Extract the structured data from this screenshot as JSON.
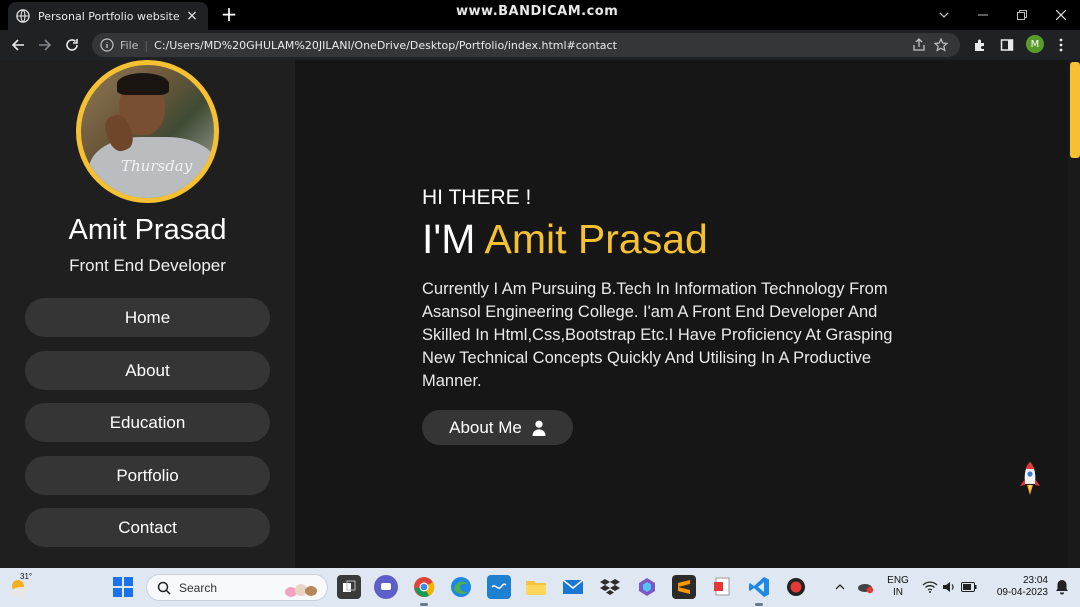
{
  "browser": {
    "tab_title": "Personal Portfolio website",
    "tab_close": "×",
    "new_tab": "+",
    "watermark": "www.BANDICAM.com",
    "omnibox_scheme": "File",
    "omnibox_sep": "|",
    "url": "C:/Users/MD%20GHULAM%20JILANI/OneDrive/Desktop/Portfolio/index.html#contact",
    "profile_initial": "M"
  },
  "sidebar": {
    "avatar_signature": "Thursday",
    "name": "Amit Prasad",
    "role": "Front End Developer",
    "nav": [
      {
        "label": "Home"
      },
      {
        "label": "About"
      },
      {
        "label": "Education"
      },
      {
        "label": "Portfolio"
      },
      {
        "label": "Contact"
      }
    ]
  },
  "main": {
    "greeting": "HI THERE !",
    "headline_prefix": "I'M",
    "headline_name": "Amit Prasad",
    "bio": "Currently I Am Pursuing B.Tech In Information Technology From Asansol Engineering College. I'am A Front End Developer And Skilled In Html,Css,Bootstrap Etc.I Have Proficiency At Grasping New Technical Concepts Quickly And Utilising In A Productive Manner.",
    "about_button": "About Me"
  },
  "taskbar": {
    "weather_temp": "31°",
    "search_placeholder": "Search",
    "lang_line1": "ENG",
    "lang_line2": "IN",
    "time": "23:04",
    "date": "09-04-2023"
  },
  "colors": {
    "accent": "#f5c133",
    "page_bg": "#161616",
    "sidebar_bg": "#1f1f1f",
    "button_bg": "#353535"
  }
}
